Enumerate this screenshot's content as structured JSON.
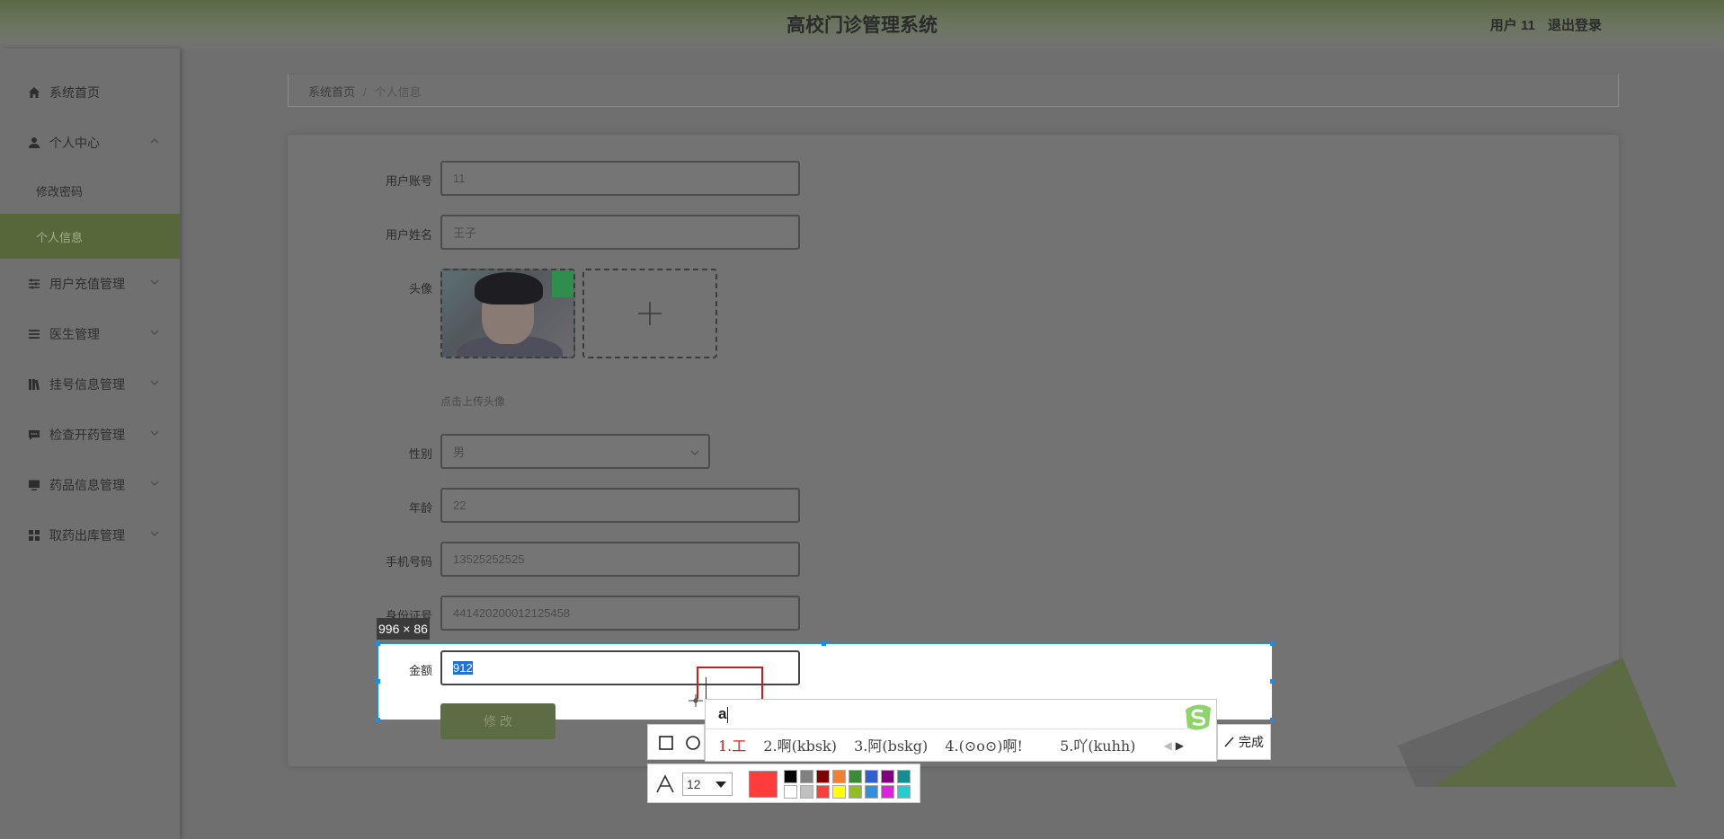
{
  "header": {
    "title": "高校门诊管理系统",
    "user": "用户 11",
    "logout": "退出登录"
  },
  "sidebar": {
    "items": [
      {
        "label": "系统首页",
        "icon": "home-icon"
      },
      {
        "label": "个人中心",
        "icon": "user-icon"
      },
      {
        "label": "修改密码"
      },
      {
        "label": "个人信息"
      },
      {
        "label": "用户充值管理",
        "icon": "sliders-icon"
      },
      {
        "label": "医生管理",
        "icon": "list-icon"
      },
      {
        "label": "挂号信息管理",
        "icon": "book-icon"
      },
      {
        "label": "检查开药管理",
        "icon": "message-icon"
      },
      {
        "label": "药品信息管理",
        "icon": "monitor-icon"
      },
      {
        "label": "取药出库管理",
        "icon": "grid-icon"
      }
    ]
  },
  "breadcrumb": {
    "home": "系统首页",
    "sep": "/",
    "current": "个人信息"
  },
  "form": {
    "account": {
      "label": "用户账号",
      "value": "11"
    },
    "name": {
      "label": "用户姓名",
      "value": "王子"
    },
    "avatar": {
      "label": "头像",
      "hint": "点击上传头像"
    },
    "gender": {
      "label": "性别",
      "value": "男"
    },
    "age": {
      "label": "年龄",
      "value": "22"
    },
    "phone": {
      "label": "手机号码",
      "value": "13525252525"
    },
    "idcard": {
      "label": "身份证号",
      "value": "441420200012125458"
    },
    "amount": {
      "label": "金额",
      "value": "912"
    },
    "submit": "修 改"
  },
  "capture": {
    "size": "996 × 86",
    "done": "完成",
    "font_size": "12",
    "current_color": "#ff3b3b",
    "palette": [
      "#000000",
      "#808080",
      "#800000",
      "#f08030",
      "#3a8a3a",
      "#3060d0",
      "#800080",
      "#109090",
      "#ffffff",
      "#c0c0c0",
      "#ff3b3b",
      "#ffff00",
      "#90c020",
      "#3090e0",
      "#e020e0",
      "#20d0d0"
    ]
  },
  "ime": {
    "composition": "a",
    "candidates": [
      "1.工",
      "2.啊(kbsk)",
      "3.阿(bskg)",
      "4.(⊙o⊙)啊!",
      "5.吖(kuhh)"
    ]
  },
  "colors": {
    "accent": "#56683a",
    "selection": "#1e8fe0",
    "ime_red": "#d0231d"
  }
}
